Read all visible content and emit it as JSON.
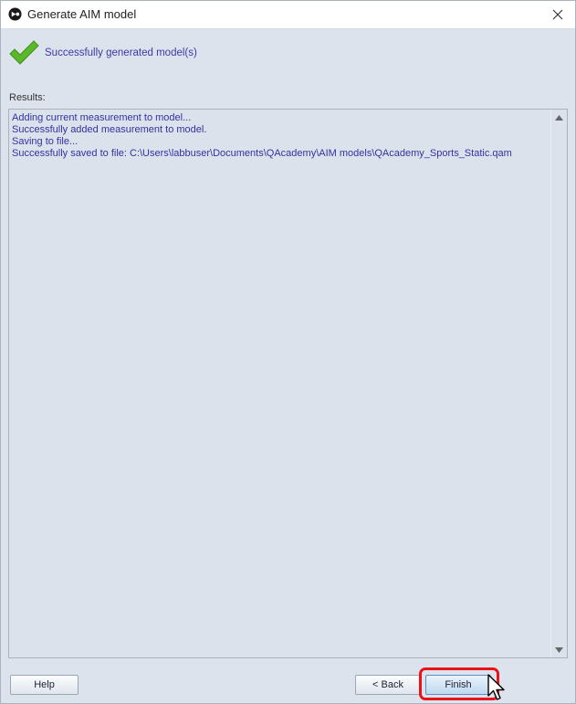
{
  "window": {
    "title": "Generate AIM model",
    "app_icon": "qualisys-logo-icon",
    "close_icon": "close-icon"
  },
  "header": {
    "status_icon": "checkmark-icon",
    "status_text": "Successfully generated model(s)",
    "accent_color": "#3a3aa8",
    "check_color": "#5bb82a"
  },
  "results": {
    "label": "Results:",
    "lines": [
      "Adding current measurement to model...",
      "Successfully added measurement to model.",
      "Saving to file...",
      "Successfully saved to file: C:\\Users\\labbuser\\Documents\\QAcademy\\AIM models\\QAcademy_Sports_Static.qam"
    ]
  },
  "buttons": {
    "help": "Help",
    "back": "< Back",
    "finish": "Finish"
  },
  "annotation": {
    "highlight_color": "#e8141a",
    "highlight_target": "finish-button"
  }
}
